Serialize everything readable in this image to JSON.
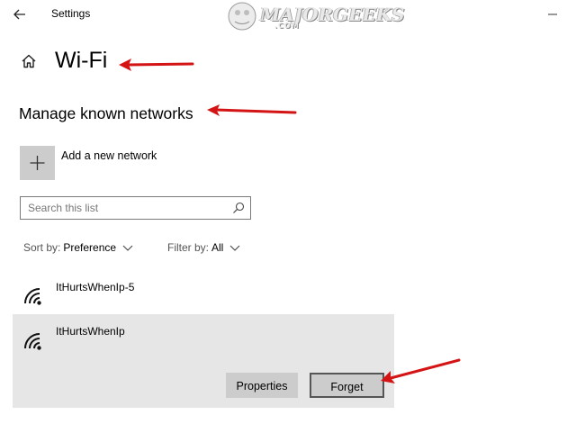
{
  "titlebar": {
    "app_title": "Settings"
  },
  "watermark": {
    "brand": "MAJORGEEKS",
    "sub": ".COM"
  },
  "header": {
    "page_title": "Wi-Fi"
  },
  "section": {
    "title": "Manage known networks"
  },
  "add_network": {
    "label": "Add a new network",
    "icon": "plus-icon"
  },
  "search": {
    "placeholder": "Search this list",
    "value": "",
    "icon": "search-icon"
  },
  "sort": {
    "label": "Sort by:",
    "value": "Preference"
  },
  "filter": {
    "label": "Filter by:",
    "value": "All"
  },
  "networks": [
    {
      "name": "ItHurtsWhenIp-5",
      "icon": "wifi-icon",
      "selected": false
    },
    {
      "name": "ItHurtsWhenIp",
      "icon": "wifi-icon",
      "selected": true,
      "buttons": [
        "Properties",
        "Forget"
      ]
    }
  ],
  "colors": {
    "annotation_arrow": "#d41414",
    "selected_bg": "#e6e6e6",
    "button_bg": "#cccccc"
  }
}
